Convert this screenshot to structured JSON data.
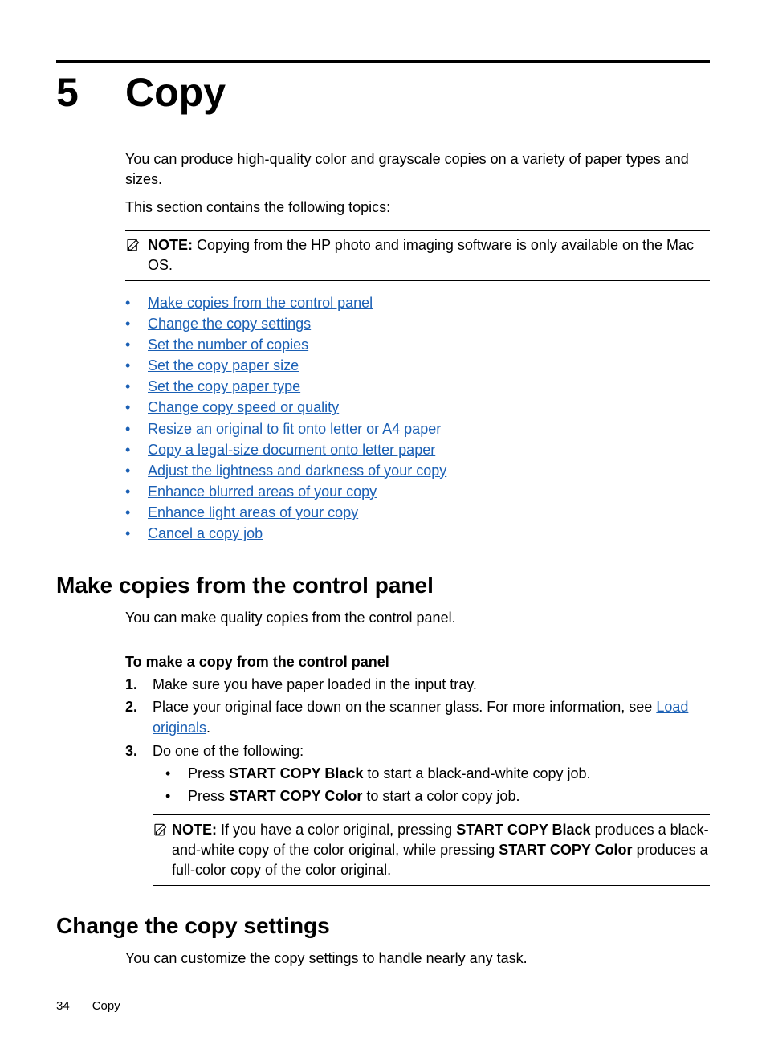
{
  "chapter": {
    "number": "5",
    "title": "Copy"
  },
  "intro1": "You can produce high-quality color and grayscale copies on a variety of paper types and sizes.",
  "intro2": "This section contains the following topics:",
  "note1": {
    "label": "NOTE:",
    "text": "Copying from the HP photo and imaging software is only available on the Mac OS."
  },
  "topics": [
    "Make copies from the control panel",
    "Change the copy settings",
    "Set the number of copies",
    "Set the copy paper size",
    "Set the copy paper type",
    "Change copy speed or quality",
    "Resize an original to fit onto letter or A4 paper",
    "Copy a legal-size document onto letter paper",
    "Adjust the lightness and darkness of your copy",
    "Enhance blurred areas of your copy",
    "Enhance light areas of your copy",
    "Cancel a copy job"
  ],
  "section1": {
    "heading": "Make copies from the control panel",
    "body": "You can make quality copies from the control panel.",
    "subheading": "To make a copy from the control panel",
    "steps": {
      "s1": "Make sure you have paper loaded in the input tray.",
      "s2_pre": "Place your original face down on the scanner glass. For more information, see ",
      "s2_link": "Load originals",
      "s2_post": ".",
      "s3": "Do one of the following:",
      "b1_pre": "Press ",
      "b1_bold": "START COPY Black",
      "b1_post": " to start a black-and-white copy job.",
      "b2_pre": "Press ",
      "b2_bold": "START COPY Color",
      "b2_post": " to start a color copy job."
    },
    "note2": {
      "label": "NOTE:",
      "pre": "If you have a color original, pressing ",
      "bold1": "START COPY Black",
      "mid": " produces a black-and-white copy of the color original, while pressing ",
      "bold2": "START COPY Color",
      "post": " produces a full-color copy of the color original."
    }
  },
  "section2": {
    "heading": "Change the copy settings",
    "body": "You can customize the copy settings to handle nearly any task."
  },
  "footer": {
    "page": "34",
    "title": "Copy"
  }
}
